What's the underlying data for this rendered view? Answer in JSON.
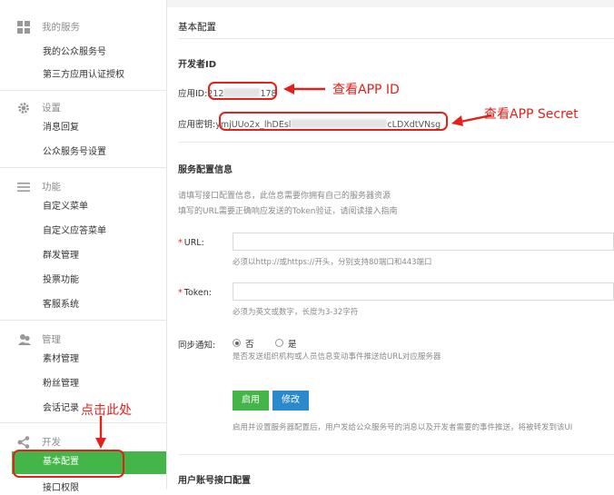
{
  "sidebar": {
    "groups": [
      {
        "label": "我的服务",
        "icon": "grid-icon",
        "items": [
          "我的公众服务号",
          "第三方应用认证授权"
        ]
      },
      {
        "label": "设置",
        "icon": "gear-icon",
        "items": [
          "消息回复",
          "公众服务号设置"
        ]
      },
      {
        "label": "功能",
        "icon": "menu-lines-icon",
        "items": [
          "自定义菜单",
          "自定义应答菜单",
          "群发管理",
          "投票功能",
          "客服系统"
        ]
      },
      {
        "label": "管理",
        "icon": "users-icon",
        "items": [
          "素材管理",
          "粉丝管理",
          "会话记录"
        ]
      },
      {
        "label": "开发",
        "icon": "share-icon",
        "items": [
          "基本配置",
          "接口权限"
        ]
      }
    ],
    "active_item": "基本配置"
  },
  "main": {
    "title": "基本配置",
    "developer": {
      "section_title": "开发者ID",
      "app_id_label": "应用ID:",
      "app_id_prefix": "212",
      "app_id_suffix": "178",
      "secret_label": "应用密钥:",
      "secret_prefix": "ymjUUo2x_lhDEsl",
      "secret_suffix": "cLDXdtVNsg"
    },
    "server": {
      "section_title": "服务配置信息",
      "desc_line1": "请填写接口配置信息，此信息需要你拥有自己的服务器资源",
      "desc_line2": "填写的URL需要正确响应发送的Token验证，请阅读接入指南",
      "required_mark": "*",
      "url_label": "URL:",
      "url_hint": "必须以http://或https://开头，分别支持80端口和443端口",
      "token_label": "Token:",
      "token_hint": "必须为英文或数字，长度为3-32字符",
      "sync_label": "同步通知:",
      "sync_no": "否",
      "sync_yes": "是",
      "sync_hint": "是否发送组织机构或人员信息变动事件推送给URL对应服务器",
      "enable_button": "启用",
      "modify_button": "修改",
      "footer_note": "启用并设置服务器配置后，用户发给公众服务号的消息以及开发者需要的事件推送，将被转发到该UI"
    },
    "user_section_title": "用户账号接口配置"
  },
  "annotations": {
    "app_id": "查看APP ID",
    "app_secret": "查看APP Secret",
    "click_here": "点击此处"
  },
  "colors": {
    "accent_green": "#44b549",
    "button_blue": "#2a8acb",
    "annotation_red": "#e3201a"
  }
}
